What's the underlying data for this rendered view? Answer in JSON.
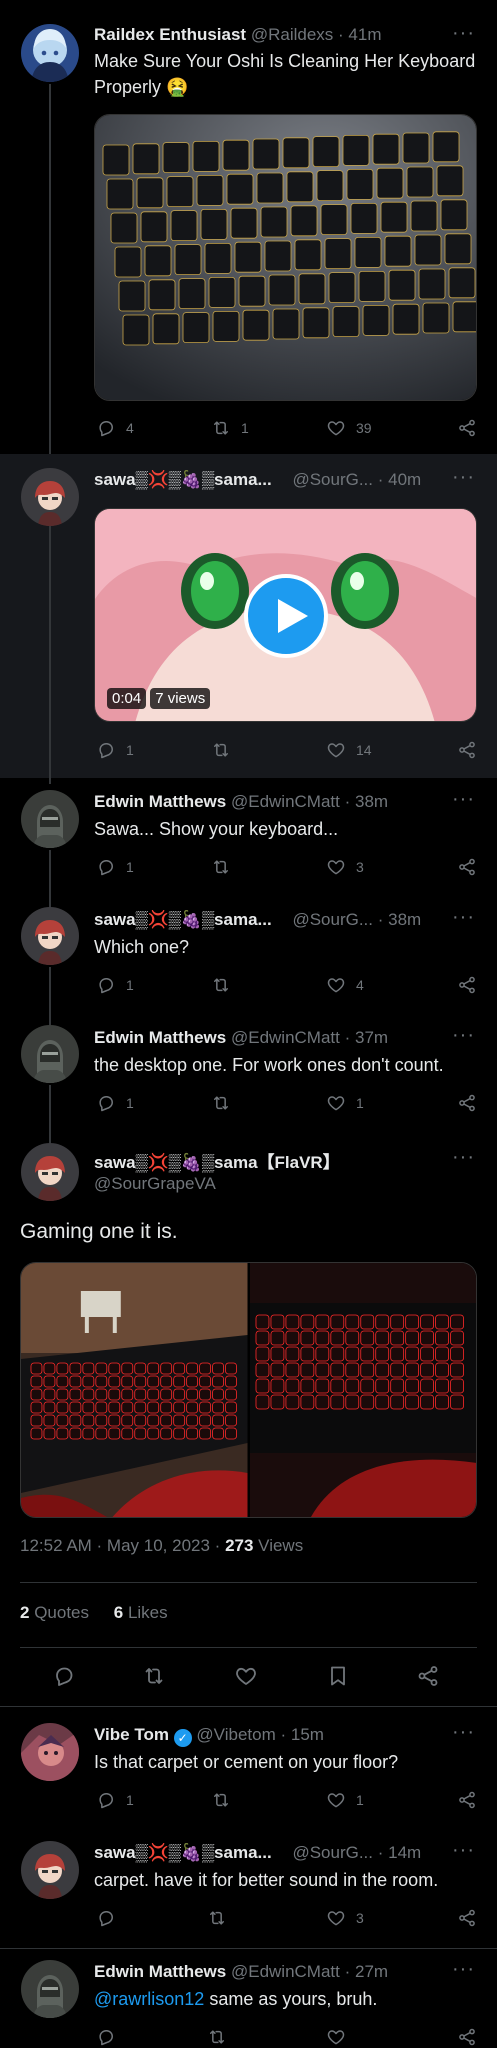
{
  "posts": [
    {
      "name": "Raildex Enthusiast",
      "handle": "@Raildexs",
      "time": "41m",
      "text": "Make Sure Your Oshi Is Cleaning Her Keyboard Properly 🤮",
      "replies": "4",
      "reposts": "1",
      "likes": "39"
    },
    {
      "name": "sawa▒💢▒🍇▒sama...",
      "handle": "@SourG...",
      "time": "40m",
      "video_duration": "0:04",
      "video_views": "7 views",
      "replies": "1",
      "reposts": "",
      "likes": "14"
    },
    {
      "name": "Edwin Matthews",
      "handle": "@EdwinCMatt",
      "time": "38m",
      "text": "Sawa... Show your keyboard...",
      "replies": "1",
      "reposts": "",
      "likes": "3"
    },
    {
      "name": "sawa▒💢▒🍇▒sama...",
      "handle": "@SourG...",
      "time": "38m",
      "text": "Which one?",
      "replies": "1",
      "reposts": "",
      "likes": "4"
    },
    {
      "name": "Edwin Matthews",
      "handle": "@EdwinCMatt",
      "time": "37m",
      "text": "the desktop one. For work ones don't count.",
      "replies": "1",
      "reposts": "",
      "likes": "1"
    }
  ],
  "main": {
    "name": "sawa▒💢▒🍇▒sama【FlaVR】",
    "handle": "@SourGrapeVA",
    "text": "Gaming one it is.",
    "timestamp": "12:52 AM · May 10, 2023 · ",
    "views_count": "273",
    "views_label": " Views",
    "quotes_count": "2",
    "quotes_label": " Quotes",
    "likes_count": "6",
    "likes_label": " Likes"
  },
  "replies": [
    {
      "name": "Vibe Tom",
      "handle": "@Vibetom",
      "time": "15m",
      "verified": true,
      "text": "Is that carpet or cement on your floor?",
      "replies": "1",
      "reposts": "",
      "likes": "1"
    },
    {
      "name": "sawa▒💢▒🍇▒sama...",
      "handle": "@SourG...",
      "time": "14m",
      "text": "carpet. have it for better sound in the room.",
      "replies": "",
      "reposts": "",
      "likes": "3"
    },
    {
      "name": "Edwin Matthews",
      "handle": "@EdwinCMatt",
      "time": "27m",
      "mention": "@rawrlison12",
      "text": " same as yours, bruh.",
      "replies": "",
      "reposts": "",
      "likes": ""
    }
  ],
  "icons": [
    "reply-icon",
    "repost-icon",
    "like-icon",
    "share-icon",
    "bookmark-icon",
    "more-icon",
    "play-icon",
    "verified-icon"
  ],
  "colors": {
    "accent": "#1d9bf0",
    "muted": "#71767b",
    "background": "#000000",
    "highlight_bg": "#16181c"
  }
}
